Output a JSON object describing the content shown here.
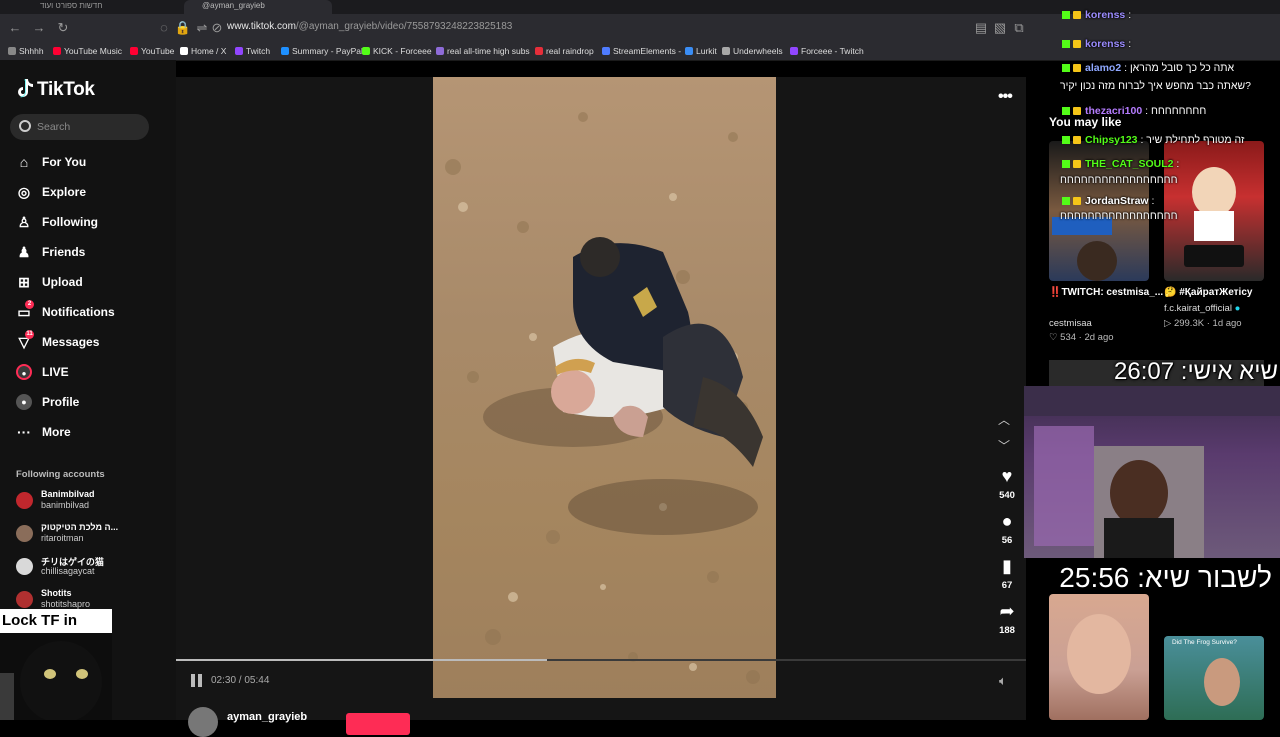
{
  "browser": {
    "tabs": [
      "חדשות ספורט ועוד",
      "@ayman_grayieb"
    ],
    "url_prefix": "www.tiktok.com",
    "url_path": "/@ayman_grayieb/video/7558793248223825183",
    "bookmarks": [
      "Shhhh",
      "YouTube Music",
      "YouTube",
      "Home / X",
      "Twitch",
      "Summary - PayPal",
      "KICK - Forceee",
      "real all-time high subs",
      "real raindrop",
      "StreamElements -",
      "Lurkit",
      "Underwheels",
      "Forceee - Twitch"
    ],
    "bookmark_colors": [
      "#888888",
      "#ff0033",
      "#ff0033",
      "#ffffff",
      "#9146ff",
      "#1e90ff",
      "#53fc18",
      "#8e6bd8",
      "#e62e3a",
      "#4f7cff",
      "#3a8df5",
      "#a8a8a8",
      "#9146ff"
    ]
  },
  "tiktok": {
    "logo": "TikTok",
    "search_placeholder": "Search",
    "nav": [
      {
        "label": "For You",
        "icon": "home-icon"
      },
      {
        "label": "Explore",
        "icon": "compass-icon"
      },
      {
        "label": "Following",
        "icon": "following-icon"
      },
      {
        "label": "Friends",
        "icon": "friends-icon"
      },
      {
        "label": "Upload",
        "icon": "upload-icon"
      },
      {
        "label": "Notifications",
        "icon": "notifications-icon",
        "badge": "2"
      },
      {
        "label": "Messages",
        "icon": "messages-icon",
        "badge": "11"
      },
      {
        "label": "LIVE",
        "icon": "live-icon"
      },
      {
        "label": "Profile",
        "icon": "profile-icon"
      },
      {
        "label": "More",
        "icon": "more-icon"
      }
    ],
    "following_title": "Following accounts",
    "following": [
      {
        "name": "Banimbilvad",
        "handle": "banimbilvad",
        "color": "#c1272d"
      },
      {
        "name": "ה מלכת הטיקטוק...",
        "handle": "ritaroitman",
        "color": "#8a6d5a"
      },
      {
        "name": "チリはゲイの猫",
        "handle": "chillisagaycat",
        "color": "#d9d9d9"
      },
      {
        "name": "Shotits",
        "handle": "shotitshapro",
        "color": "#b03030"
      }
    ],
    "video": {
      "time": "02:30 / 05:44",
      "progress": 0.436,
      "author": "ayman_grayieb"
    },
    "actions": [
      {
        "icon": "heart-icon",
        "count": "540"
      },
      {
        "icon": "comment-icon",
        "count": "56"
      },
      {
        "icon": "bookmark-icon",
        "count": "67"
      },
      {
        "icon": "share-icon",
        "count": "188"
      }
    ],
    "may_like_title": "You may like",
    "cards": [
      {
        "title": "‼️TWITCH: cestmisa_...",
        "author": "cestmisaa",
        "likes": "534",
        "age": "2d ago"
      },
      {
        "title": "🤔 #ҚайратЖетісу",
        "author": "f.c.kairat_official",
        "likes": "299.3K",
        "age": "1d ago"
      }
    ]
  },
  "overlay": {
    "caption": "Lock TF in",
    "chat": [
      {
        "user": "korenss",
        "text": "",
        "color": "#9b8cff"
      },
      {
        "user": "korenss",
        "text": "",
        "color": "#9b8cff"
      },
      {
        "user": "alamo2",
        "text": "אתה כל כך סובל מהראן",
        "color": "#8fa8ff"
      },
      {
        "user": "",
        "text": "שאתה כבר מחפש איך לברוח מזה נכון יקיר?",
        "color": "#ffffff"
      },
      {
        "user": "thezacri100",
        "text": "חחחחחחחח",
        "color": "#b57cff"
      },
      {
        "user": "Chipsy123",
        "text": "זה מטורף לתחילת שיר",
        "color": "#53fc18"
      },
      {
        "user": "THE_CAT_SOUL2",
        "text": "",
        "color": "#53fc18"
      },
      {
        "user": "",
        "text": "חחחחחחחחחחחחחחחחח",
        "color": "#ffffff"
      },
      {
        "user": "JordanStraw",
        "text": "",
        "color": "#ffffff"
      },
      {
        "user": "",
        "text": "חחחחחחחחחחחחחחחחח",
        "color": "#ffffff"
      }
    ],
    "timer_top": "שיא אישי: 26:07",
    "timer_bottom": "לשבור שיא: 25:56",
    "frog_title": "Did The Frog Survive?"
  }
}
